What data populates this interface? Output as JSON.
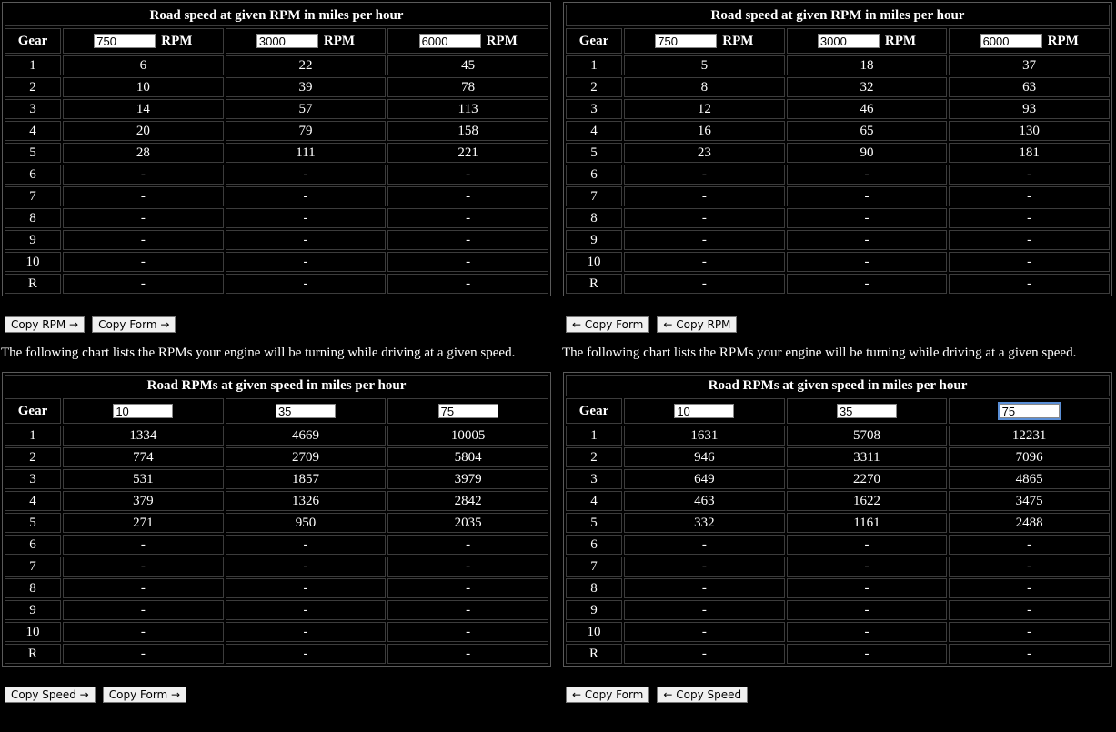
{
  "top": {
    "title": "Road speed at given RPM in miles per hour",
    "gear_header": "Gear",
    "unit": "RPM",
    "left": {
      "inputs": [
        "750",
        "3000",
        "6000"
      ],
      "rows": [
        [
          "1",
          "6",
          "22",
          "45"
        ],
        [
          "2",
          "10",
          "39",
          "78"
        ],
        [
          "3",
          "14",
          "57",
          "113"
        ],
        [
          "4",
          "20",
          "79",
          "158"
        ],
        [
          "5",
          "28",
          "111",
          "221"
        ],
        [
          "6",
          "-",
          "-",
          "-"
        ],
        [
          "7",
          "-",
          "-",
          "-"
        ],
        [
          "8",
          "-",
          "-",
          "-"
        ],
        [
          "9",
          "-",
          "-",
          "-"
        ],
        [
          "10",
          "-",
          "-",
          "-"
        ],
        [
          "R",
          "-",
          "-",
          "-"
        ]
      ],
      "buttons": [
        "Copy RPM →",
        "Copy Form →"
      ]
    },
    "right": {
      "inputs": [
        "750",
        "3000",
        "6000"
      ],
      "rows": [
        [
          "1",
          "5",
          "18",
          "37"
        ],
        [
          "2",
          "8",
          "32",
          "63"
        ],
        [
          "3",
          "12",
          "46",
          "93"
        ],
        [
          "4",
          "16",
          "65",
          "130"
        ],
        [
          "5",
          "23",
          "90",
          "181"
        ],
        [
          "6",
          "-",
          "-",
          "-"
        ],
        [
          "7",
          "-",
          "-",
          "-"
        ],
        [
          "8",
          "-",
          "-",
          "-"
        ],
        [
          "9",
          "-",
          "-",
          "-"
        ],
        [
          "10",
          "-",
          "-",
          "-"
        ],
        [
          "R",
          "-",
          "-",
          "-"
        ]
      ],
      "buttons": [
        "← Copy Form",
        "← Copy RPM"
      ]
    }
  },
  "description": "The following chart lists the RPMs your engine will be turning while driving at a given speed.",
  "bottom": {
    "title": "Road RPMs at given speed in miles per hour",
    "gear_header": "Gear",
    "left": {
      "inputs": [
        "10",
        "35",
        "75"
      ],
      "rows": [
        [
          "1",
          "1334",
          "4669",
          "10005"
        ],
        [
          "2",
          "774",
          "2709",
          "5804"
        ],
        [
          "3",
          "531",
          "1857",
          "3979"
        ],
        [
          "4",
          "379",
          "1326",
          "2842"
        ],
        [
          "5",
          "271",
          "950",
          "2035"
        ],
        [
          "6",
          "-",
          "-",
          "-"
        ],
        [
          "7",
          "-",
          "-",
          "-"
        ],
        [
          "8",
          "-",
          "-",
          "-"
        ],
        [
          "9",
          "-",
          "-",
          "-"
        ],
        [
          "10",
          "-",
          "-",
          "-"
        ],
        [
          "R",
          "-",
          "-",
          "-"
        ]
      ],
      "buttons": [
        "Copy Speed →",
        "Copy Form →"
      ]
    },
    "right": {
      "inputs": [
        "10",
        "35",
        "75"
      ],
      "rows": [
        [
          "1",
          "1631",
          "5708",
          "12231"
        ],
        [
          "2",
          "946",
          "3311",
          "7096"
        ],
        [
          "3",
          "649",
          "2270",
          "4865"
        ],
        [
          "4",
          "463",
          "1622",
          "3475"
        ],
        [
          "5",
          "332",
          "1161",
          "2488"
        ],
        [
          "6",
          "-",
          "-",
          "-"
        ],
        [
          "7",
          "-",
          "-",
          "-"
        ],
        [
          "8",
          "-",
          "-",
          "-"
        ],
        [
          "9",
          "-",
          "-",
          "-"
        ],
        [
          "10",
          "-",
          "-",
          "-"
        ],
        [
          "R",
          "-",
          "-",
          "-"
        ]
      ],
      "buttons": [
        "← Copy Form",
        "← Copy Speed"
      ]
    }
  }
}
